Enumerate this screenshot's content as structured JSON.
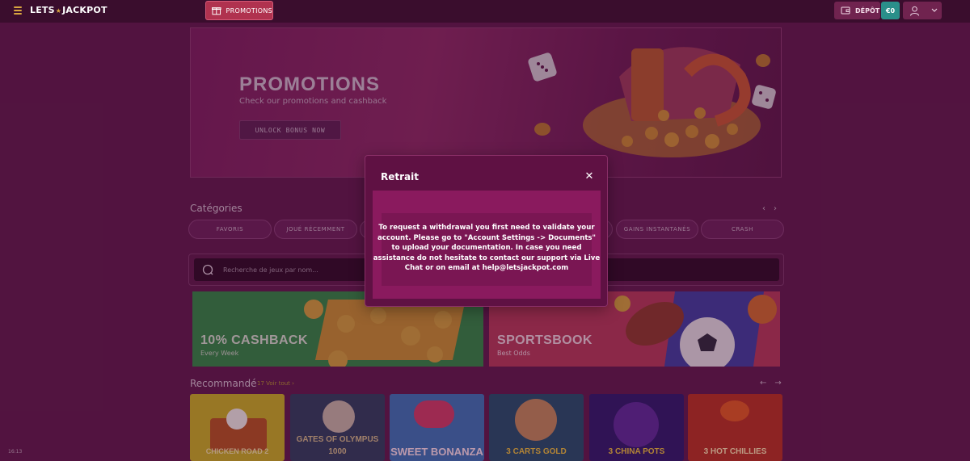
{
  "header": {
    "logo_left": "LETS",
    "logo_right": "JACKPOT",
    "promotions_label": "PROMOTIONS",
    "deposit_label": "DÉPÔT",
    "balance": "€0"
  },
  "hero": {
    "title": "PROMOTIONS",
    "subtitle": "Check our promotions and cashback",
    "cta": "UNLOCK BONUS NOW"
  },
  "categories": {
    "title": "Catégories",
    "items": [
      {
        "label": "FAVORIS"
      },
      {
        "label": "JOUÉ RÉCEMMENT"
      },
      {
        "label": "GAINS INSTANTANÉS"
      },
      {
        "label": "CRASH"
      }
    ]
  },
  "search": {
    "placeholder": "Recherche de jeux par nom..."
  },
  "promo_cards": [
    {
      "title": "10% CASHBACK",
      "subtitle": "Every Week"
    },
    {
      "title": "SPORTSBOOK",
      "subtitle": "Best Odds"
    }
  ],
  "recommended": {
    "title": "Recommandé",
    "see_all": "17 Voir tout",
    "games": [
      {
        "label": "CHICKEN ROAD 2"
      },
      {
        "label": "GATES OF OLYMPUS 1000"
      },
      {
        "label": "SWEET BONANZA"
      },
      {
        "label": "3 CARTS GOLD"
      },
      {
        "label": "3 CHINA POTS"
      },
      {
        "label": "3 HOT CHILLIES"
      }
    ]
  },
  "clock": "16:13",
  "modal": {
    "title": "Retrait",
    "message": "To request a withdrawal you first need to validate your account. Please go to \"Account Settings -> Documents\" to upload your documentation. In case you need assistance do not hesitate to contact our support via Live Chat or on email at help@letsjackpot.com"
  },
  "colors": {
    "background": "#5e1a4a",
    "header": "#3a0d2d",
    "promotions_button": "#b0324f",
    "balance_button": "#2a8f8a",
    "gold_accent": "#d9a640",
    "modal": "#5f1143",
    "modal_body": "#8a1a5e"
  },
  "icons": [
    "hamburger-icon",
    "gift-icon",
    "wallet-icon",
    "user-icon",
    "chevron-down-icon",
    "search-icon",
    "close-icon",
    "arrow-left-icon",
    "arrow-right-icon"
  ]
}
